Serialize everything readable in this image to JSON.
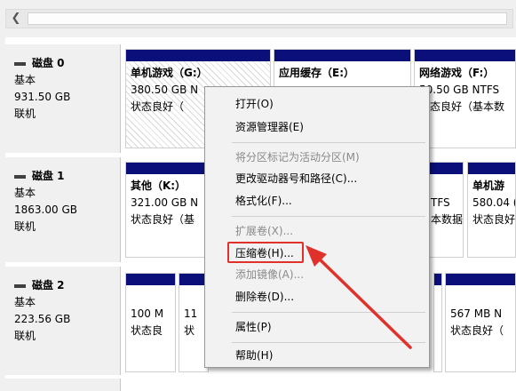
{
  "disks": [
    {
      "title": "磁盘 0",
      "type": "基本",
      "size": "931.50 GB",
      "status": "联机",
      "volumes": [
        {
          "name": "单机游戏（G:）",
          "size": "380.50 GB N",
          "state": "状态良好（",
          "selected": true
        },
        {
          "name": "应用缓存（E:）",
          "size": "",
          "state": ""
        },
        {
          "name": "网络游戏（F:）",
          "size": "50.50 GB NTFS",
          "state": "状态良好（基本数"
        }
      ]
    },
    {
      "title": "磁盘 1",
      "type": "基本",
      "size": "1863.00 GB",
      "status": "联机",
      "volumes": [
        {
          "name": "其他（K:）",
          "size": "321.00 GB N",
          "state": "状态良好（基"
        },
        {
          "name": "",
          "size": "TFS",
          "state": "本数据"
        },
        {
          "name": "单机游",
          "size": "580.04 (",
          "state": "状态良好"
        }
      ]
    },
    {
      "title": "磁盘 2",
      "type": "基本",
      "size": "223.56 GB",
      "status": "联机",
      "volumes": [
        {
          "name": "",
          "size": "100 M",
          "state": "状态良"
        },
        {
          "name": "",
          "size": "11",
          "state": "状"
        },
        {
          "name": "",
          "size": "567 MB N",
          "state": "状态良好（"
        }
      ]
    }
  ],
  "context_menu": {
    "items": [
      {
        "label": "打开(O)",
        "enabled": true
      },
      {
        "label": "资源管理器(E)",
        "enabled": true
      },
      {
        "label": "将分区标记为活动分区(M)",
        "enabled": false
      },
      {
        "label": "更改驱动器号和路径(C)...",
        "enabled": true
      },
      {
        "label": "格式化(F)...",
        "enabled": true
      },
      {
        "label": "扩展卷(X)...",
        "enabled": false
      },
      {
        "label": "压缩卷(H)...",
        "enabled": true,
        "highlighted": true
      },
      {
        "label": "添加镜像(A)...",
        "enabled": false
      },
      {
        "label": "删除卷(D)...",
        "enabled": true
      },
      {
        "label": "属性(P)",
        "enabled": true
      },
      {
        "label": "帮助(H)",
        "enabled": true
      }
    ]
  },
  "icons": {
    "scroll_left": "chevron-left-icon",
    "disk": "disk-icon"
  },
  "colors": {
    "volume_bar": "#0a0f7a",
    "annotation": "#e0312b",
    "menu_bg": "#f2f2f2"
  }
}
